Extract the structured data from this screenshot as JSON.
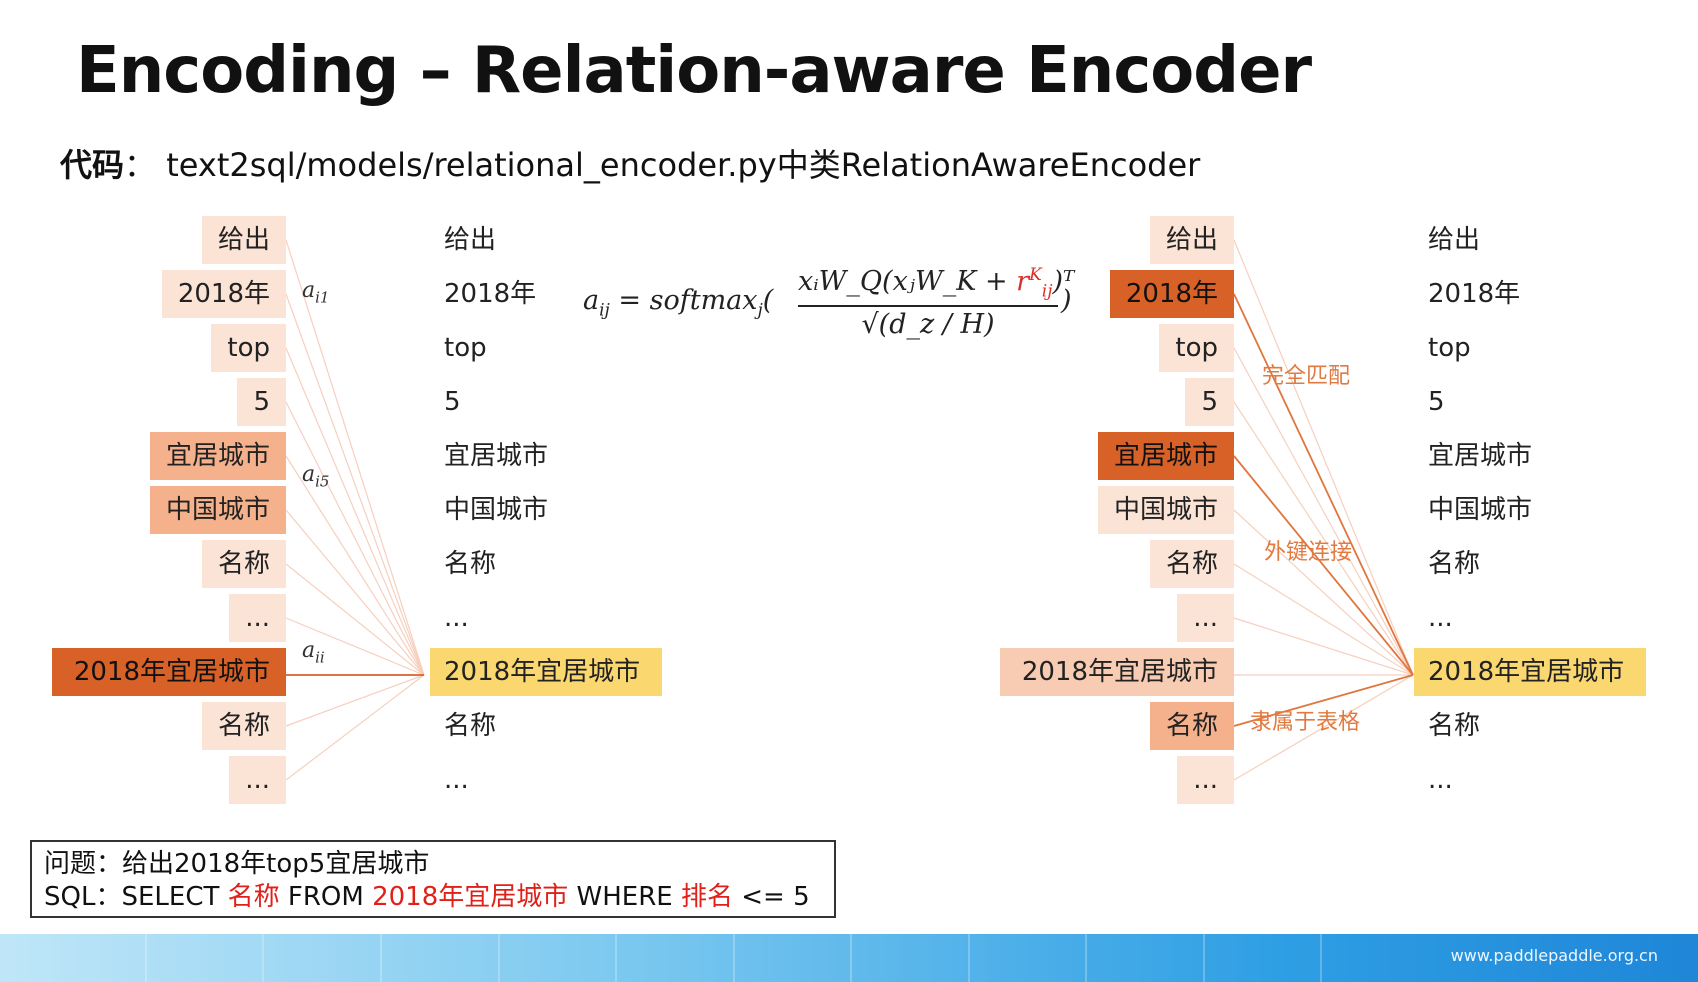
{
  "title": "Encoding – Relation-aware Encoder",
  "code": {
    "label": "代码",
    "sep": "：",
    "path": "text2sql/models/relational_encoder.py中类RelationAwareEncoder"
  },
  "left_diagram": {
    "input_tokens": [
      "给出",
      "2018年",
      "top",
      "5",
      "宜居城市",
      "中国城市",
      "名称",
      "...",
      "2018年宜居城市",
      "名称",
      "..."
    ],
    "output_tokens": [
      "给出",
      "2018年",
      "top",
      "5",
      "宜居城市",
      "中国城市",
      "名称",
      "...",
      "2018年宜居城市",
      "名称",
      "..."
    ],
    "attention_labels": [
      {
        "base": "a",
        "sub": "i1"
      },
      {
        "base": "a",
        "sub": "i5"
      },
      {
        "base": "a",
        "sub": "ii"
      }
    ]
  },
  "formula": {
    "lhs": "a",
    "lhs_sub": "ij",
    "eq": " = softmax",
    "eq_sub": "j",
    "num": "xᵢW_Q(xⱼW_K + ",
    "num_red": "r",
    "num_red_sup": "K",
    "num_red_sub": "ij",
    "num_end": ")ᵀ",
    "den": "√(d_z / H)"
  },
  "right_diagram": {
    "input_tokens": [
      "给出",
      "2018年",
      "top",
      "5",
      "宜居城市",
      "中国城市",
      "名称",
      "...",
      "2018年宜居城市",
      "名称",
      "..."
    ],
    "output_tokens": [
      "给出",
      "2018年",
      "top",
      "5",
      "宜居城市",
      "中国城市",
      "名称",
      "...",
      "2018年宜居城市",
      "名称",
      "..."
    ],
    "relation_labels": [
      "完全匹配",
      "外键连接",
      "隶属于表格"
    ]
  },
  "question": {
    "q_label": "问题：",
    "q_text": "给出2018年top5宜居城市",
    "sql_label": "SQL：",
    "sql_select": "SELECT ",
    "sql_col": "名称",
    "sql_from": "  FROM ",
    "sql_table": "2018年宜居城市",
    "sql_where": " WHERE ",
    "sql_cond": "排名",
    "sql_end": " <= 5"
  },
  "footer": {
    "url": "www.paddlepaddle.org.cn"
  },
  "colors": {
    "token_light": "#fbe3d6",
    "token_mid": "#f8ccb2",
    "token_strong": "#f4b18c",
    "token_dark": "#d86128",
    "target": "#fbd86f",
    "relation_text": "#e07a40",
    "sql_highlight": "#e0211a"
  }
}
